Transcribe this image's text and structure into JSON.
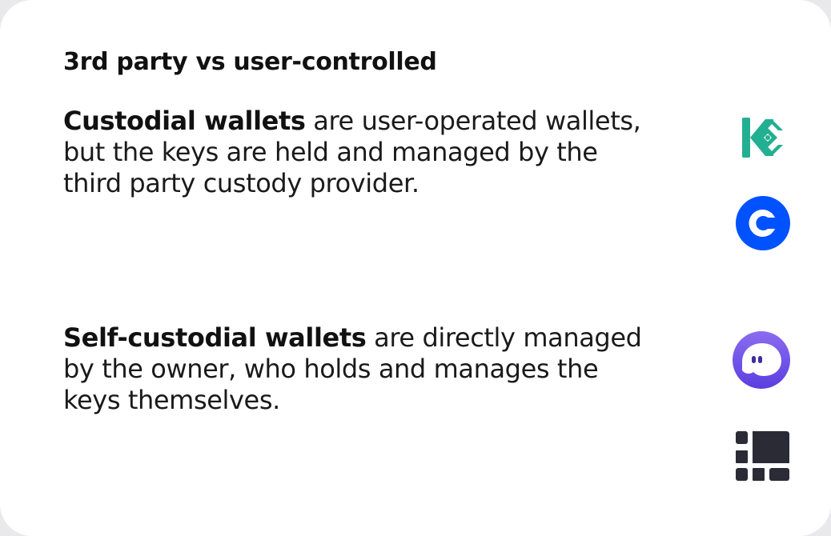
{
  "heading": "3rd party vs user-controlled",
  "custodial": {
    "term": "Custodial wallets",
    "description": " are user-operated wallets, but the keys are held and managed by the third party custody provider."
  },
  "self_custodial": {
    "term": "Self-custodial wallets",
    "description": " are directly managed by the owner, who holds and manages the keys themselves."
  },
  "icons": {
    "kucoin": "kucoin-logo-icon",
    "coinbase": "coinbase-logo-icon",
    "phantom": "phantom-logo-icon",
    "ledger": "ledger-logo-icon"
  },
  "colors": {
    "card_background": "#ffffff",
    "page_background": "#e9e9ec",
    "text": "#111111",
    "kucoin_green": "#23af91",
    "coinbase_blue": "#0052ff",
    "phantom_purple": "#6a4ee8",
    "ledger_dark": "#2b2b36"
  }
}
